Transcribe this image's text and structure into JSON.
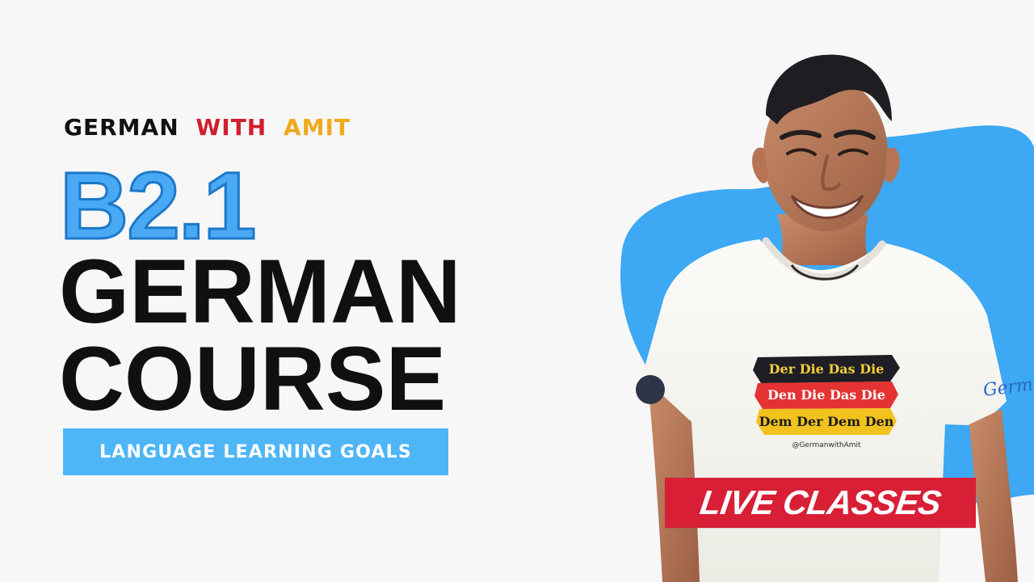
{
  "header": {
    "brand_part1": "GERMAN",
    "brand_part2": "WITH",
    "brand_part3": "AMIT"
  },
  "content": {
    "level": "B2.1",
    "title_line1": "GERMAN",
    "title_line2": "COURSE",
    "subtitle": "LANGUAGE LEARNING GOALS",
    "badge": "LIVE CLASSES"
  },
  "shirt_print": {
    "line1": "Der Die Das Die",
    "line2": "Den Die Das Die",
    "line3": "Dem Der Dem Den",
    "handle": "@GermanwithAmit",
    "sleeve_text": "Germ"
  },
  "colors": {
    "background": "#f7f7f8",
    "accent_blue": "#4aa9f5",
    "banner_blue": "#4eb6f7",
    "red": "#d81f36",
    "gold": "#f0a81c",
    "black": "#101010"
  },
  "icons": {
    "presenter": "presenter-illustration-icon",
    "badge": "live-badge",
    "shape": "blue-blob-icon"
  }
}
